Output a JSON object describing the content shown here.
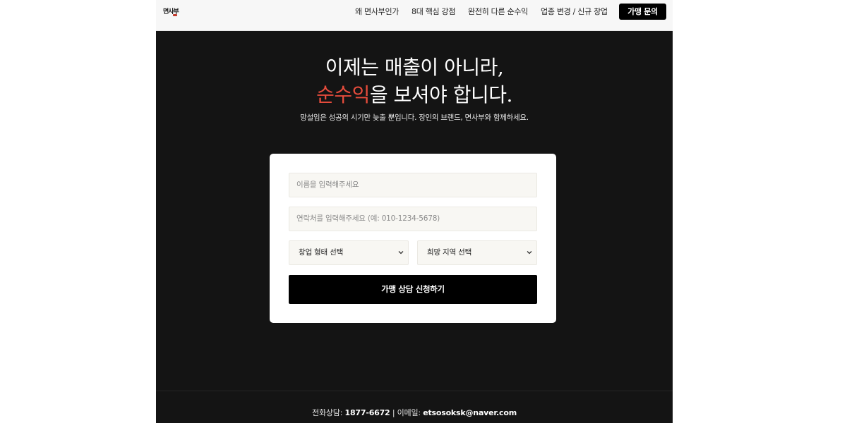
{
  "header": {
    "logo_text": "면사부",
    "nav": [
      "왜 면사부인가",
      "8대 핵심 강점",
      "완전히 다른 순수익",
      "업종 변경 / 신규 창업"
    ],
    "cta_label": "가맹 문의"
  },
  "hero": {
    "title_line1": "이제는 매출이 아니라,",
    "title_accent": "순수익",
    "title_line2_rest": "을 보셔야 합니다.",
    "subtitle": "망설임은 성공의 시기만 늦출 뿐입니다. 장인의 브랜드, 면사부와 함께하세요."
  },
  "form": {
    "name_placeholder": "이름을 입력해주세요",
    "phone_placeholder": "연락처를 입력해주세요 (예: 010-1234-5678)",
    "startup_type_selected": "창업 형태 선택",
    "region_selected": "희망 지역 선택",
    "submit_label": "가맹 상담 신청하기"
  },
  "footer": {
    "phone_label": "전화상담:",
    "phone": "1877-6672",
    "separator": "|",
    "email_label": "이메일:",
    "email": "etsosoksk@naver.com"
  },
  "colors": {
    "accent": "#e74c3c",
    "background": "#141414",
    "button": "#000000"
  },
  "icons": {
    "select_chevron": "chevron-down-icon"
  }
}
